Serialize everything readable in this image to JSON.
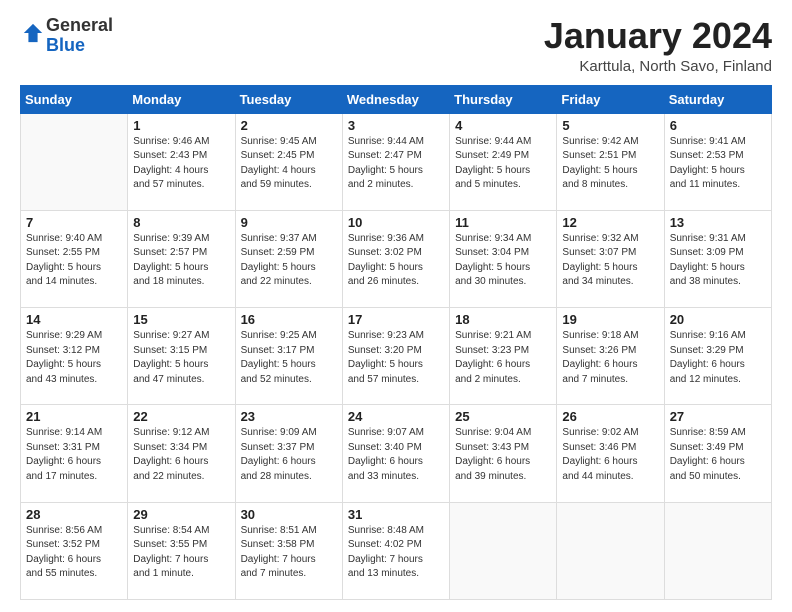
{
  "logo": {
    "general": "General",
    "blue": "Blue"
  },
  "header": {
    "month": "January 2024",
    "location": "Karttula, North Savo, Finland"
  },
  "weekdays": [
    "Sunday",
    "Monday",
    "Tuesday",
    "Wednesday",
    "Thursday",
    "Friday",
    "Saturday"
  ],
  "weeks": [
    [
      {
        "day": "",
        "info": ""
      },
      {
        "day": "1",
        "info": "Sunrise: 9:46 AM\nSunset: 2:43 PM\nDaylight: 4 hours\nand 57 minutes."
      },
      {
        "day": "2",
        "info": "Sunrise: 9:45 AM\nSunset: 2:45 PM\nDaylight: 4 hours\nand 59 minutes."
      },
      {
        "day": "3",
        "info": "Sunrise: 9:44 AM\nSunset: 2:47 PM\nDaylight: 5 hours\nand 2 minutes."
      },
      {
        "day": "4",
        "info": "Sunrise: 9:44 AM\nSunset: 2:49 PM\nDaylight: 5 hours\nand 5 minutes."
      },
      {
        "day": "5",
        "info": "Sunrise: 9:42 AM\nSunset: 2:51 PM\nDaylight: 5 hours\nand 8 minutes."
      },
      {
        "day": "6",
        "info": "Sunrise: 9:41 AM\nSunset: 2:53 PM\nDaylight: 5 hours\nand 11 minutes."
      }
    ],
    [
      {
        "day": "7",
        "info": "Sunrise: 9:40 AM\nSunset: 2:55 PM\nDaylight: 5 hours\nand 14 minutes."
      },
      {
        "day": "8",
        "info": "Sunrise: 9:39 AM\nSunset: 2:57 PM\nDaylight: 5 hours\nand 18 minutes."
      },
      {
        "day": "9",
        "info": "Sunrise: 9:37 AM\nSunset: 2:59 PM\nDaylight: 5 hours\nand 22 minutes."
      },
      {
        "day": "10",
        "info": "Sunrise: 9:36 AM\nSunset: 3:02 PM\nDaylight: 5 hours\nand 26 minutes."
      },
      {
        "day": "11",
        "info": "Sunrise: 9:34 AM\nSunset: 3:04 PM\nDaylight: 5 hours\nand 30 minutes."
      },
      {
        "day": "12",
        "info": "Sunrise: 9:32 AM\nSunset: 3:07 PM\nDaylight: 5 hours\nand 34 minutes."
      },
      {
        "day": "13",
        "info": "Sunrise: 9:31 AM\nSunset: 3:09 PM\nDaylight: 5 hours\nand 38 minutes."
      }
    ],
    [
      {
        "day": "14",
        "info": "Sunrise: 9:29 AM\nSunset: 3:12 PM\nDaylight: 5 hours\nand 43 minutes."
      },
      {
        "day": "15",
        "info": "Sunrise: 9:27 AM\nSunset: 3:15 PM\nDaylight: 5 hours\nand 47 minutes."
      },
      {
        "day": "16",
        "info": "Sunrise: 9:25 AM\nSunset: 3:17 PM\nDaylight: 5 hours\nand 52 minutes."
      },
      {
        "day": "17",
        "info": "Sunrise: 9:23 AM\nSunset: 3:20 PM\nDaylight: 5 hours\nand 57 minutes."
      },
      {
        "day": "18",
        "info": "Sunrise: 9:21 AM\nSunset: 3:23 PM\nDaylight: 6 hours\nand 2 minutes."
      },
      {
        "day": "19",
        "info": "Sunrise: 9:18 AM\nSunset: 3:26 PM\nDaylight: 6 hours\nand 7 minutes."
      },
      {
        "day": "20",
        "info": "Sunrise: 9:16 AM\nSunset: 3:29 PM\nDaylight: 6 hours\nand 12 minutes."
      }
    ],
    [
      {
        "day": "21",
        "info": "Sunrise: 9:14 AM\nSunset: 3:31 PM\nDaylight: 6 hours\nand 17 minutes."
      },
      {
        "day": "22",
        "info": "Sunrise: 9:12 AM\nSunset: 3:34 PM\nDaylight: 6 hours\nand 22 minutes."
      },
      {
        "day": "23",
        "info": "Sunrise: 9:09 AM\nSunset: 3:37 PM\nDaylight: 6 hours\nand 28 minutes."
      },
      {
        "day": "24",
        "info": "Sunrise: 9:07 AM\nSunset: 3:40 PM\nDaylight: 6 hours\nand 33 minutes."
      },
      {
        "day": "25",
        "info": "Sunrise: 9:04 AM\nSunset: 3:43 PM\nDaylight: 6 hours\nand 39 minutes."
      },
      {
        "day": "26",
        "info": "Sunrise: 9:02 AM\nSunset: 3:46 PM\nDaylight: 6 hours\nand 44 minutes."
      },
      {
        "day": "27",
        "info": "Sunrise: 8:59 AM\nSunset: 3:49 PM\nDaylight: 6 hours\nand 50 minutes."
      }
    ],
    [
      {
        "day": "28",
        "info": "Sunrise: 8:56 AM\nSunset: 3:52 PM\nDaylight: 6 hours\nand 55 minutes."
      },
      {
        "day": "29",
        "info": "Sunrise: 8:54 AM\nSunset: 3:55 PM\nDaylight: 7 hours\nand 1 minute."
      },
      {
        "day": "30",
        "info": "Sunrise: 8:51 AM\nSunset: 3:58 PM\nDaylight: 7 hours\nand 7 minutes."
      },
      {
        "day": "31",
        "info": "Sunrise: 8:48 AM\nSunset: 4:02 PM\nDaylight: 7 hours\nand 13 minutes."
      },
      {
        "day": "",
        "info": ""
      },
      {
        "day": "",
        "info": ""
      },
      {
        "day": "",
        "info": ""
      }
    ]
  ]
}
